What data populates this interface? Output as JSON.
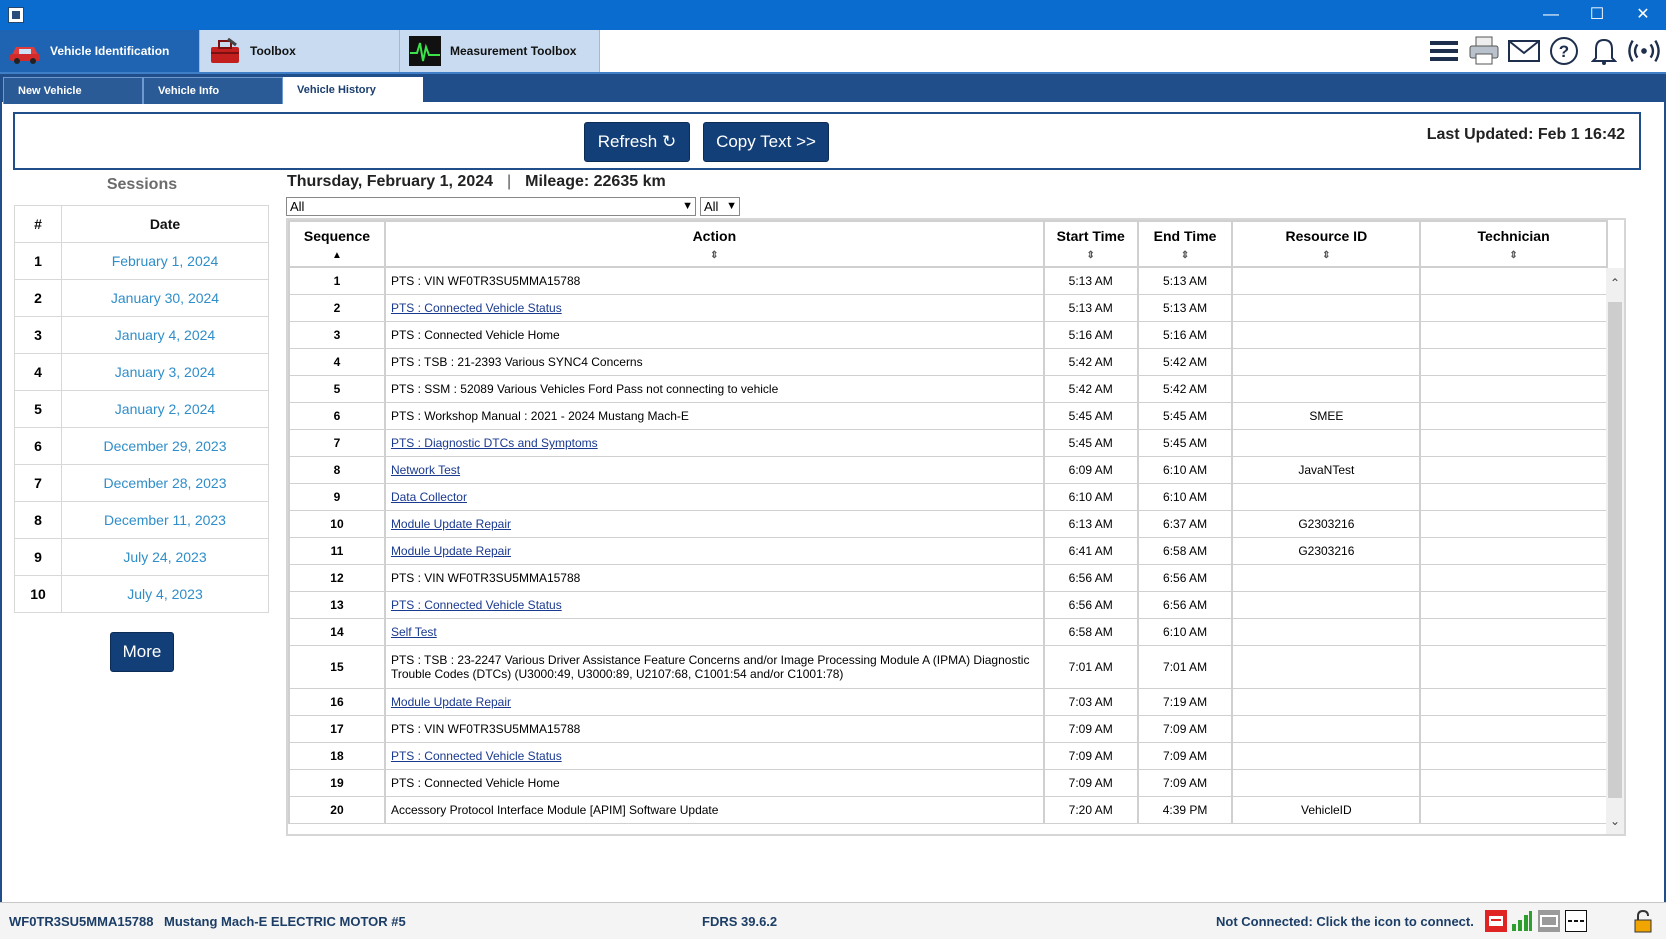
{
  "window": {
    "minimize": "—",
    "maximize": "☐",
    "close": "✕"
  },
  "modules": [
    {
      "label": "Vehicle Identification",
      "icon": "car-icon"
    },
    {
      "label": "Toolbox",
      "icon": "toolbox-icon"
    },
    {
      "label": "Measurement Toolbox",
      "icon": "oscilloscope-icon"
    }
  ],
  "tools": [
    "menu-icon",
    "printer-icon",
    "mail-icon",
    "help-icon",
    "bell-icon",
    "wireless-icon"
  ],
  "subtabs": [
    "New Vehicle",
    "Vehicle Info",
    "Vehicle History"
  ],
  "toolbar": {
    "refresh": "Refresh",
    "copy": "Copy Text >>",
    "last_updated": "Last Updated: Feb 1 16:42"
  },
  "sessions": {
    "title": "Sessions",
    "headers": [
      "#",
      "Date"
    ],
    "rows": [
      [
        "1",
        "February 1, 2024"
      ],
      [
        "2",
        "January 30, 2024"
      ],
      [
        "3",
        "January 4, 2024"
      ],
      [
        "4",
        "January 3, 2024"
      ],
      [
        "5",
        "January 2, 2024"
      ],
      [
        "6",
        "December 29, 2023"
      ],
      [
        "7",
        "December 28, 2023"
      ],
      [
        "8",
        "December 11, 2023"
      ],
      [
        "9",
        "July 24, 2023"
      ],
      [
        "10",
        "July 4, 2023"
      ]
    ],
    "more": "More"
  },
  "history": {
    "date": "Thursday, February 1, 2024",
    "sep": "|",
    "mileage": "Mileage: 22635 km",
    "filter1": "All",
    "filter2": "All",
    "headers": [
      "Sequence",
      "Action",
      "Start Time",
      "End Time",
      "Resource ID",
      "Technician"
    ],
    "rows": [
      {
        "seq": "1",
        "action": "PTS : VIN WF0TR3SU5MMA15788",
        "link": false,
        "start": "5:13 AM",
        "end": "5:13 AM",
        "res": "",
        "tech": ""
      },
      {
        "seq": "2",
        "action": "PTS : Connected Vehicle Status",
        "link": true,
        "start": "5:13 AM",
        "end": "5:13 AM",
        "res": "",
        "tech": ""
      },
      {
        "seq": "3",
        "action": "PTS : Connected Vehicle Home",
        "link": false,
        "start": "5:16 AM",
        "end": "5:16 AM",
        "res": "",
        "tech": ""
      },
      {
        "seq": "4",
        "action": "PTS : TSB : 21-2393 Various SYNC4 Concerns",
        "link": false,
        "start": "5:42 AM",
        "end": "5:42 AM",
        "res": "",
        "tech": ""
      },
      {
        "seq": "5",
        "action": "PTS : SSM : 52089 Various Vehicles Ford Pass not connecting to vehicle",
        "link": false,
        "start": "5:42 AM",
        "end": "5:42 AM",
        "res": "",
        "tech": ""
      },
      {
        "seq": "6",
        "action": "PTS : Workshop Manual : 2021 - 2024 Mustang Mach-E",
        "link": false,
        "start": "5:45 AM",
        "end": "5:45 AM",
        "res": "SMEE",
        "tech": ""
      },
      {
        "seq": "7",
        "action": "PTS : Diagnostic DTCs and Symptoms",
        "link": true,
        "start": "5:45 AM",
        "end": "5:45 AM",
        "res": "",
        "tech": ""
      },
      {
        "seq": "8",
        "action": "Network Test",
        "link": true,
        "start": "6:09 AM",
        "end": "6:10 AM",
        "res": "JavaNTest",
        "tech": ""
      },
      {
        "seq": "9",
        "action": "Data Collector",
        "link": true,
        "start": "6:10 AM",
        "end": "6:10 AM",
        "res": "",
        "tech": ""
      },
      {
        "seq": "10",
        "action": "Module Update Repair",
        "link": true,
        "start": "6:13 AM",
        "end": "6:37 AM",
        "res": "G2303216",
        "tech": ""
      },
      {
        "seq": "11",
        "action": "Module Update Repair",
        "link": true,
        "start": "6:41 AM",
        "end": "6:58 AM",
        "res": "G2303216",
        "tech": ""
      },
      {
        "seq": "12",
        "action": "PTS : VIN WF0TR3SU5MMA15788",
        "link": false,
        "start": "6:56 AM",
        "end": "6:56 AM",
        "res": "",
        "tech": ""
      },
      {
        "seq": "13",
        "action": "PTS : Connected Vehicle Status",
        "link": true,
        "start": "6:56 AM",
        "end": "6:56 AM",
        "res": "",
        "tech": ""
      },
      {
        "seq": "14",
        "action": "Self Test",
        "link": true,
        "start": "6:58 AM",
        "end": "6:10 AM",
        "res": "",
        "tech": ""
      },
      {
        "seq": "15",
        "action": "PTS : TSB : 23-2247 Various Driver Assistance Feature Concerns and/or Image Processing Module A (IPMA) Diagnostic Trouble Codes (DTCs) (U3000:49, U3000:89, U2107:68, C1001:54 and/or C1001:78)",
        "link": false,
        "start": "7:01 AM",
        "end": "7:01 AM",
        "res": "",
        "tech": "",
        "tall": true
      },
      {
        "seq": "16",
        "action": "Module Update Repair",
        "link": true,
        "start": "7:03 AM",
        "end": "7:19 AM",
        "res": "",
        "tech": ""
      },
      {
        "seq": "17",
        "action": "PTS : VIN WF0TR3SU5MMA15788",
        "link": false,
        "start": "7:09 AM",
        "end": "7:09 AM",
        "res": "",
        "tech": ""
      },
      {
        "seq": "18",
        "action": "PTS : Connected Vehicle Status",
        "link": true,
        "start": "7:09 AM",
        "end": "7:09 AM",
        "res": "",
        "tech": ""
      },
      {
        "seq": "19",
        "action": "PTS : Connected Vehicle Home",
        "link": false,
        "start": "7:09 AM",
        "end": "7:09 AM",
        "res": "",
        "tech": ""
      },
      {
        "seq": "20",
        "action": "Accessory Protocol Interface Module [APIM] Software Update",
        "link": false,
        "start": "7:20 AM",
        "end": "4:39 PM",
        "res": "VehicleID",
        "tech": ""
      }
    ]
  },
  "status": {
    "vin": "WF0TR3SU5MMA15788",
    "vehicle": "Mustang Mach-E ELECTRIC MOTOR #5",
    "version": "FDRS 39.6.2",
    "connection": "Not Connected: Click the icon to connect."
  },
  "colors": {
    "titlebar": "#0a6ccf",
    "nav": "#1f4e8a",
    "button": "#133f78",
    "link_date": "#2f8ec9"
  }
}
